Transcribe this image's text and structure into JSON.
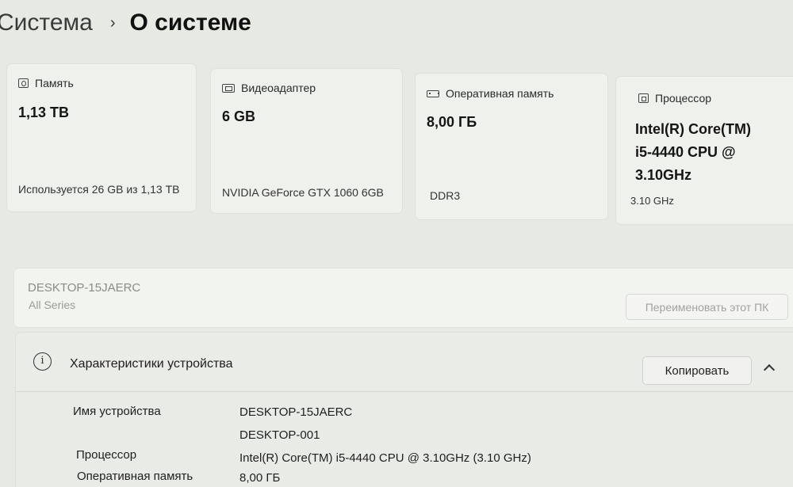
{
  "breadcrumb": {
    "parent": "Система",
    "separator": "›",
    "current": "О системе"
  },
  "cards": [
    {
      "icon": "storage-icon",
      "label": "Память",
      "value": "1,13 TB",
      "sub": "Используется 26 GB из 1,13 TB"
    },
    {
      "icon": "gpu-icon",
      "label": "Видеоадаптер",
      "value": "6 GB",
      "sub": "NVIDIA GeForce GTX 1060 6GB"
    },
    {
      "icon": "ram-icon",
      "label": "Оперативная память",
      "value": "8,00 ГБ",
      "sub": "DDR3"
    },
    {
      "icon": "cpu-icon",
      "label": "Процессор",
      "value_lines": [
        "Intel(R) Core(TM)",
        "i5-4440 CPU @",
        "3.10GHz"
      ],
      "sub": "3.10 GHz"
    }
  ],
  "device": {
    "name": "DESKTOP-15JAERC",
    "model": "All Series",
    "rename_button": "Переименовать этот ПК"
  },
  "specs": {
    "icon": "info-icon",
    "title": "Характеристики устройства",
    "copy_button": "Копировать",
    "rows": [
      {
        "key": "Имя устройства",
        "value": "DESKTOP-15JAERC"
      },
      {
        "key": "",
        "value": "DESKTOP-001"
      },
      {
        "key": "Процессор",
        "value": "Intel(R) Core(TM) i5-4440 CPU @ 3.10GHz (3.10 GHz)"
      },
      {
        "key": "Оперативная память",
        "value": "8,00 ГБ"
      }
    ]
  }
}
